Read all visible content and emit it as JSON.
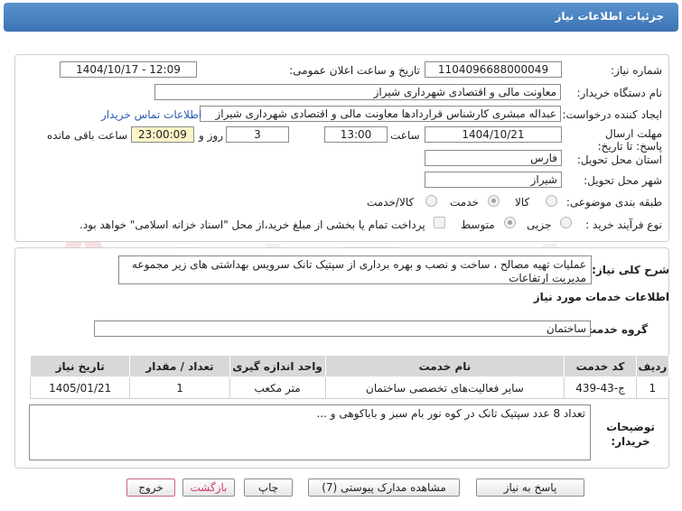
{
  "header": {
    "title": "جزئیات اطلاعات نیاز"
  },
  "fields": {
    "need_number_label": "شماره نیاز:",
    "need_number": "1104096688000049",
    "announce_label": "تاریخ و ساعت اعلان عمومی:",
    "announce_value": "1404/10/17 - 12:09",
    "buyer_org_label": "نام دستگاه خریدار:",
    "buyer_org": "معاونت مالی و اقتصادی شهرداری شیراز",
    "requester_label": "ایجاد کننده درخواست:",
    "requester": "عبداله مبشری کارشناس قراردادها معاونت مالی و اقتصادی شهرداری شیراز",
    "contact_link": "اطلاعات تماس خریدار",
    "deadline_label": "مهلت ارسال پاسخ: تا تاریخ:",
    "deadline_date": "1404/10/21",
    "time_label": "ساعت",
    "deadline_time": "13:00",
    "days_value": "3",
    "days_label": "روز و",
    "remaining_time": "23:00:09",
    "remaining_label": "ساعت باقی مانده",
    "province_label": "استان محل تحویل:",
    "province": "فارس",
    "city_label": "شهر محل تحویل:",
    "city": "شیراز",
    "category_label": "طبقه بندی موضوعی:",
    "category_options": [
      "کالا",
      "خدمت",
      "کالا/خدمت"
    ],
    "category_selected": "خدمت",
    "process_label": "نوع فرآیند خرید :",
    "process_options": [
      "جزیی",
      "متوسط"
    ],
    "process_selected": "متوسط",
    "payment_note": "پرداخت تمام یا بخشی از مبلغ خرید،از محل \"اسناد خزانه اسلامی\" خواهد بود."
  },
  "summary": {
    "label": "شرح کلی نیاز:",
    "text": "عملیات تهیه مصالح ، ساخت و نصب و بهره برداری از سپتیک تانک سرویس بهداشتی های زیر مجموعه مدیریت ارتفاعات"
  },
  "services": {
    "section_title": "اطلاعات خدمات مورد نیاز",
    "group_label": "گروه خدمت:",
    "group_value": "ساختمان",
    "columns": [
      "ردیف",
      "کد خدمت",
      "نام خدمت",
      "واحد اندازه گیری",
      "تعداد / مقدار",
      "تاریخ نیاز"
    ],
    "rows": [
      [
        "1",
        "ج-43-439",
        "سایر فعالیت‌های تخصصی ساختمان",
        "متر مکعب",
        "1",
        "1405/01/21"
      ]
    ]
  },
  "buyer_notes": {
    "label": "توضیحات خریدار:",
    "text": "تعداد 8 عدد سپتیک تانک در کوه نور بام سبز و باباکوهی و ..."
  },
  "buttons": {
    "reply": "پاسخ به نیاز",
    "attachments": "مشاهده مدارک پیوستی (7)",
    "print": "چاپ",
    "back": "بازگشت",
    "exit": "خروج"
  },
  "watermark": {
    "text": "AriaTender.net"
  },
  "colors": {
    "header": "#3c72b2",
    "highlight": "#fbf5c8",
    "link": "#2a5db0",
    "back_text": "#d0406a",
    "exit_border": "#c9667c",
    "watermark": "#d22020"
  }
}
